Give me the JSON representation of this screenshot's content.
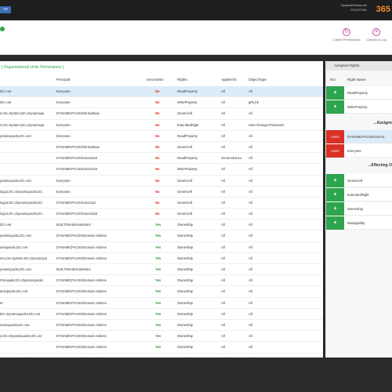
{
  "topbar": {
    "logo": "co",
    "user_line1": "DynamicPacks.net",
    "user_line2": "PICO77991",
    "brand": "365"
  },
  "toolbar": {
    "collect_permissions": "Collect Permissions",
    "collection_log": "Collection Log"
  },
  "main": {
    "title": "[ Organizational Units Permissions ]",
    "columns": [
      "Principal",
      "IsAnAdmin",
      "Rights",
      "AppliesTo",
      "ObjectType"
    ],
    "rows": [
      {
        "dn": "DC=net",
        "principal": "Everyone",
        "admin": "No",
        "rights": "ReadProperty",
        "applies": "All",
        "otype": "All"
      },
      {
        "dn": "DC=net",
        "principal": "Everyone",
        "admin": "No",
        "rights": "WriteProperty",
        "applies": "All",
        "otype": "gPLink"
      },
      {
        "dn": "s,CN=System,DC=Dynamicpa",
        "principal": "DYNAMICPACKS\\NirmalNew",
        "admin": "No",
        "rights": "GenericAll",
        "applies": "All",
        "otype": "All"
      },
      {
        "dn": "s,CN=System,DC=Dynamicpa",
        "principal": "Everyone",
        "admin": "No",
        "rights": "ExtendedRight",
        "applies": "All",
        "otype": "User-Change-Password"
      },
      {
        "dn": "ynamicpacks,DC=net",
        "principal": "Everyone",
        "admin": "No",
        "rights": "ReadProperty",
        "applies": "All",
        "otype": "All"
      },
      {
        "dn": "",
        "principal": "DYNAMICPACKS\\NirmalNew",
        "admin": "No",
        "rights": "GenericAll",
        "applies": "All",
        "otype": "All"
      },
      {
        "dn": "",
        "principal": "DYNAMICPACKS\\User1104",
        "admin": "No",
        "rights": "ReadProperty",
        "applies": "GenericExecu",
        "otype": "All"
      },
      {
        "dn": "",
        "principal": "DYNAMICPACKS\\User1104",
        "admin": "No",
        "rights": "WriteProperty",
        "applies": "All",
        "otype": "All"
      },
      {
        "dn": "ynamicpacks,DC=net",
        "principal": "Everyone",
        "admin": "No",
        "rights": "GenericAll",
        "applies": "All",
        "otype": "All"
      },
      {
        "dn": "ing12,DC=Dynamicpacks,DC",
        "principal": "Everyone",
        "admin": "No",
        "rights": "GenericAll",
        "applies": "All",
        "otype": "All"
      },
      {
        "dn": "ing13,DC=Dynamicpacks,DC",
        "principal": "DYNAMICPACKS\\User112",
        "admin": "No",
        "rights": "GenericAll",
        "applies": "All",
        "otype": "All"
      },
      {
        "dn": "ing14,DC=Dynamicpacks,DC",
        "principal": "DYNAMICPACKS\\User1154",
        "admin": "No",
        "rights": "GenericAll",
        "applies": "All",
        "otype": "All"
      },
      {
        "dn": "DC=net",
        "principal": "BUILTIN\\Administrators",
        "admin": "Yes",
        "rights": "Ownership",
        "applies": "All",
        "otype": "All"
      },
      {
        "dn": "ynamicpacks,DC=net",
        "principal": "DYNAMICPACKS\\Domain Admins",
        "admin": "Yes",
        "rights": "Ownership",
        "applies": "All",
        "otype": "All"
      },
      {
        "dn": "amicpacks,DC=net",
        "principal": "DYNAMICPACKS\\Domain Admins",
        "admin": "Yes",
        "rights": "Ownership",
        "applies": "All",
        "otype": "All"
      },
      {
        "dn": "ers,CN=System,DC=Dynamicpa",
        "principal": "DYNAMICPACKS\\Domain Admins",
        "admin": "Yes",
        "rights": "Ownership",
        "applies": "All",
        "otype": "All"
      },
      {
        "dn": "ynamicpacks,DC=net",
        "principal": "BUILTIN\\Administrators",
        "admin": "Yes",
        "rights": "Ownership",
        "applies": "All",
        "otype": "All"
      },
      {
        "dn": "Principals,DC=Dynamicpacks",
        "principal": "DYNAMICPACKS\\Domain Admins",
        "admin": "Yes",
        "rights": "Ownership",
        "applies": "All",
        "otype": "All"
      },
      {
        "dn": "amicpacks,DC=net",
        "principal": "DYNAMICPACKS\\Domain Admins",
        "admin": "Yes",
        "rights": "Ownership",
        "applies": "All",
        "otype": "All"
      },
      {
        "dn": "et",
        "principal": "DYNAMICPACKS\\Domain Admins",
        "admin": "Yes",
        "rights": "Ownership",
        "applies": "All",
        "otype": "All"
      },
      {
        "dn": "DC=Dynamicpacks,DC=net",
        "principal": "DYNAMICPACKS\\Domain Admins",
        "admin": "Yes",
        "rights": "Ownership",
        "applies": "All",
        "otype": "All"
      },
      {
        "dn": "namicpacks,DC=net",
        "principal": "DYNAMICPACKS\\Domain Admins",
        "admin": "Yes",
        "rights": "Ownership",
        "applies": "All",
        "otype": "All"
      },
      {
        "dn": "2,DC=Dynamicpacks,DC=ne",
        "principal": "DYNAMICPACKS\\Domain Admins",
        "admin": "Yes",
        "rights": "Ownership",
        "applies": "All",
        "otype": "All"
      },
      {
        "dn": "",
        "principal": "DYNAMICPACKS\\Domain Admins",
        "admin": "Yes",
        "rights": "Ownership",
        "applies": "All",
        "otype": "All"
      },
      {
        "dn": "1,DC=Dynamicpacks,DC=ne",
        "principal": "DYNAMICPACKS\\Domain Admins",
        "admin": "Yes",
        "rights": "Ownership",
        "applies": "All",
        "otype": "All"
      }
    ]
  },
  "side": {
    "title": "Assigned Rights",
    "col_no": "NO.",
    "col_name": "Right Name",
    "rights_top": [
      "ReadProperty",
      "WriteProperty"
    ],
    "section_assigned": "...Assigne",
    "users_label": "USER",
    "users": [
      "DYNAMICPACKS\\User11",
      "Everyone"
    ],
    "section_affecting": "...Affecting O",
    "rights_bottom": [
      "GenericAll",
      "ExtendedRight",
      "Ownership",
      "ManagedBy"
    ]
  }
}
